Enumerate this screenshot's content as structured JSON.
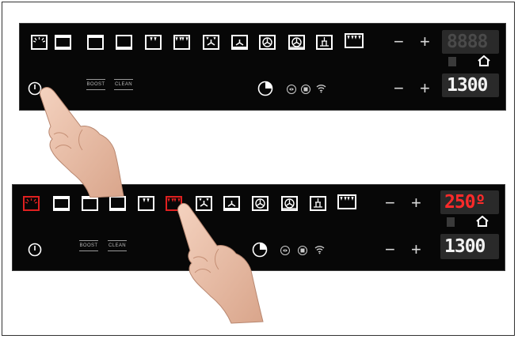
{
  "panel_before": {
    "boost_label": "BOOST",
    "clean_label": "CLEAN",
    "minus": "−",
    "plus": "+",
    "temperature_display": "8888",
    "time_display": "1300"
  },
  "panel_after": {
    "boost_label": "BOOST",
    "clean_label": "CLEAN",
    "minus": "−",
    "plus": "+",
    "temperature_display": "250º",
    "time_display": "1300"
  },
  "colors": {
    "panel_bg": "#070707",
    "active_red": "#e02020",
    "display_bg": "#2a2a2a",
    "icon_white": "#ffffff"
  },
  "icons": [
    "power-icon",
    "grill-light-icon",
    "bottom-heat-icon",
    "top-bottom-heat-icon",
    "fan-heat-icon",
    "timer-icon",
    "media-icon",
    "wifi-icon",
    "home-icon",
    "lock-icon"
  ]
}
